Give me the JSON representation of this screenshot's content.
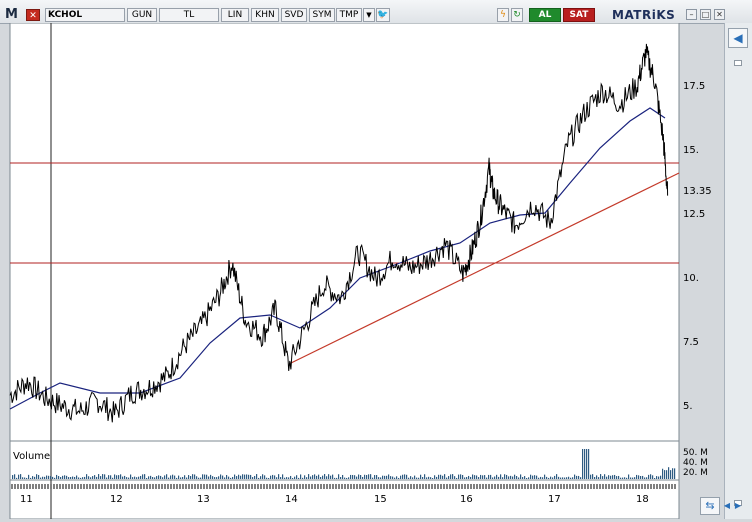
{
  "toolbar": {
    "logo": "M",
    "symbol": "KCHOL",
    "buttons": [
      "GUN",
      "TL",
      "LIN",
      "KHN",
      "SVD",
      "SYM",
      "TMP"
    ],
    "dropdown": "▼",
    "buy": "AL",
    "sell": "SAT",
    "brand": "MATRiKS"
  },
  "chart": {
    "y_ticks": [
      "17.5",
      "15.",
      "13.35",
      "12.5",
      "10.",
      "7.5",
      "5."
    ],
    "x_ticks": [
      "11",
      "12",
      "13",
      "14",
      "15",
      "16",
      "17",
      "18"
    ],
    "volume_label": "Volume",
    "volume_ticks": [
      "50. M",
      "40. M",
      "20. M"
    ]
  },
  "colors": {
    "price": "#000000",
    "ma": "#1a237e",
    "hline": "#b22222",
    "trend": "#c43a2a",
    "volume": "#2e5b82"
  },
  "chart_data": {
    "type": "line",
    "series": [
      {
        "x": [
          2010.8,
          2011.0,
          2011.2,
          2011.4,
          2011.6,
          2011.8,
          2012.0,
          2012.2,
          2012.4,
          2012.6,
          2012.8,
          2013.0,
          2013.2,
          2013.35,
          2013.5,
          2013.7,
          2013.85,
          2014.0,
          2014.2,
          2014.4,
          2014.6,
          2014.8,
          2015.0,
          2015.2,
          2015.4,
          2015.6,
          2015.8,
          2016.0,
          2016.1,
          2016.2,
          2016.3,
          2016.35,
          2016.45,
          2016.6,
          2016.8,
          2017.0,
          2017.2,
          2017.4,
          2017.6,
          2017.8,
          2018.0,
          2018.1,
          2018.2,
          2018.3,
          2018.35
        ],
        "values": [
          5.7,
          6.2,
          5.6,
          5.3,
          5.1,
          5.5,
          5.0,
          5.8,
          6.0,
          6.4,
          7.5,
          8.3,
          9.4,
          10.6,
          8.5,
          7.9,
          8.9,
          6.8,
          8.3,
          9.8,
          9.3,
          11.0,
          10.0,
          10.8,
          10.4,
          10.7,
          11.3,
          10.2,
          11.0,
          12.2,
          14.1,
          13.2,
          12.6,
          12.0,
          12.8,
          12.1,
          15.0,
          16.2,
          17.0,
          16.5,
          17.2,
          18.4,
          17.4,
          15.2,
          13.1
        ]
      }
    ],
    "ylim": [
      4.0,
      19.5
    ],
    "xlim": [
      2010.8,
      2018.4
    ]
  }
}
